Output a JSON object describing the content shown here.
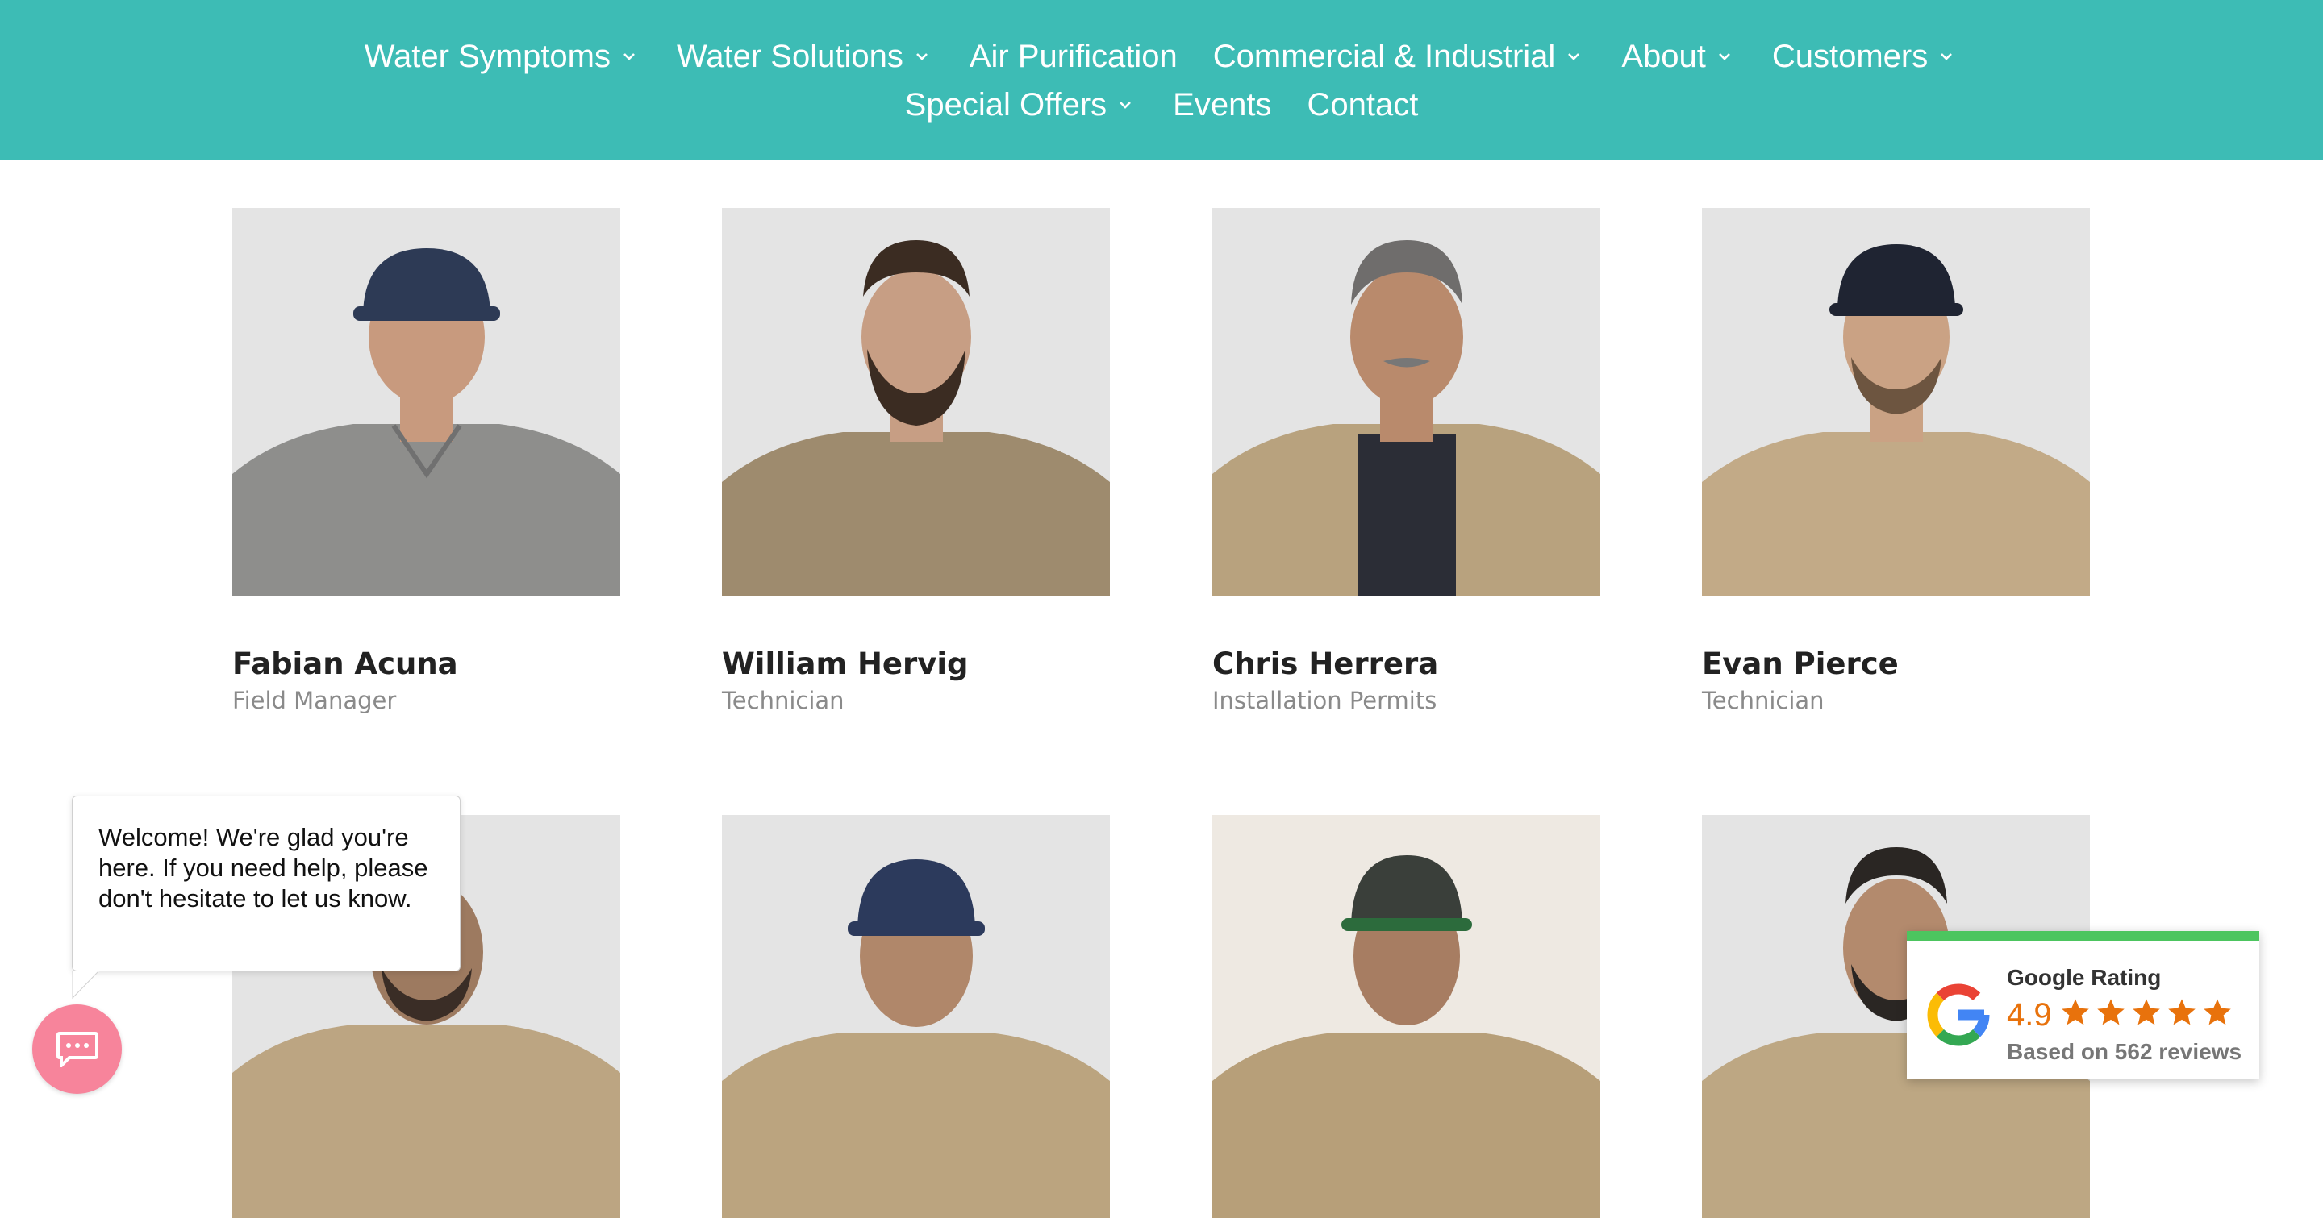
{
  "nav": {
    "row1": [
      {
        "label": "Water Symptoms",
        "dropdown": true
      },
      {
        "label": "Water Solutions",
        "dropdown": true
      },
      {
        "label": "Air Purification",
        "dropdown": false
      },
      {
        "label": "Commercial & Industrial",
        "dropdown": true
      },
      {
        "label": "About",
        "dropdown": true
      },
      {
        "label": "Customers",
        "dropdown": true
      }
    ],
    "row2": [
      {
        "label": "Special Offers",
        "dropdown": true
      },
      {
        "label": "Events",
        "dropdown": false
      },
      {
        "label": "Contact",
        "dropdown": false
      }
    ]
  },
  "team": [
    {
      "name": "Fabian Acuna",
      "role": "Field Manager"
    },
    {
      "name": "William Hervig",
      "role": "Technician"
    },
    {
      "name": "Chris Herrera",
      "role": "Installation Permits"
    },
    {
      "name": "Evan Pierce",
      "role": "Technician"
    }
  ],
  "chat": {
    "welcome": "Welcome! We're glad you're here. If you need help, please don't hesitate to let us know.",
    "launcher_icon": "chat-bubble-icon"
  },
  "rating": {
    "title": "Google Rating",
    "score": "4.9",
    "stars": 5,
    "subtitle": "Based on 562 reviews"
  },
  "colors": {
    "nav_bg": "#3dbcb5",
    "chat_launcher": "#f7849b",
    "rating_score": "#e8720c",
    "rating_bar": "#4cc55f"
  }
}
